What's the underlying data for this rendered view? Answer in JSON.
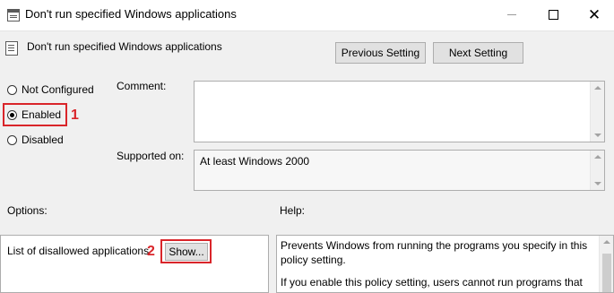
{
  "window": {
    "title": "Don't run specified Windows applications",
    "minimize_icon": "minimize-icon",
    "maximize_icon": "maximize-icon",
    "close_glyph": "✕"
  },
  "header": {
    "policy_name": "Don't run specified Windows applications",
    "prev_button": "Previous Setting",
    "next_button": "Next Setting"
  },
  "state": {
    "options": [
      {
        "label": "Not Configured",
        "checked": false
      },
      {
        "label": "Enabled",
        "checked": true
      },
      {
        "label": "Disabled",
        "checked": false
      }
    ]
  },
  "comment": {
    "label": "Comment:",
    "value": ""
  },
  "supported": {
    "label": "Supported on:",
    "value": "At least Windows 2000"
  },
  "options": {
    "label": "Options:",
    "list_label": "List of disallowed applications",
    "show_button": "Show..."
  },
  "help": {
    "label": "Help:",
    "paragraphs": [
      "Prevents Windows from running the programs you specify in this policy setting.",
      "If you enable this policy setting, users cannot run programs that"
    ]
  },
  "annotations": {
    "marker1": "1",
    "marker2": "2",
    "color": "#d9252a"
  }
}
